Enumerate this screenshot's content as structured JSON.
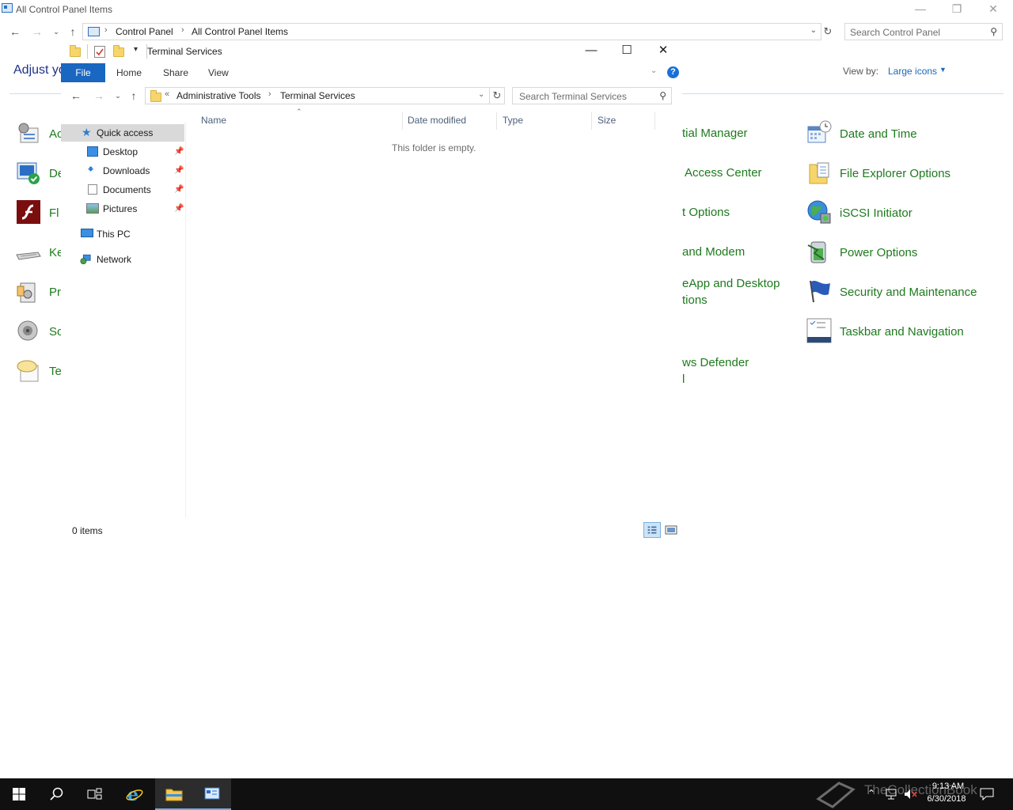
{
  "control_panel": {
    "title": "All Control Panel Items",
    "breadcrumb": [
      "Control Panel",
      "All Control Panel Items"
    ],
    "search_placeholder": "Search Control Panel",
    "heading": "Adjust yo",
    "view_by_label": "View by:",
    "view_by_value": "Large icons",
    "left_items": [
      "Ac",
      "De",
      "Fl",
      "Ke",
      "Pr",
      "So",
      "Te"
    ],
    "middle_partial": [
      "tial Manager",
      "Access Center",
      "t Options",
      "and Modem",
      "eApp and Desktop",
      "tions",
      "ws Defender",
      "l"
    ],
    "right_items": [
      "Date and Time",
      "File Explorer Options",
      "iSCSI Initiator",
      "Power Options",
      "Security and Maintenance",
      "Taskbar and Navigation"
    ]
  },
  "explorer": {
    "title": "Terminal Services",
    "ribbon_tabs": [
      "File",
      "Home",
      "Share",
      "View"
    ],
    "help_glyph": "?",
    "breadcrumb_overflow": "«",
    "breadcrumb": [
      "Administrative Tools",
      "Terminal Services"
    ],
    "search_placeholder": "Search Terminal Services",
    "nav": {
      "quick_access": "Quick access",
      "desktop": "Desktop",
      "downloads": "Downloads",
      "documents": "Documents",
      "pictures": "Pictures",
      "this_pc": "This PC",
      "network": "Network"
    },
    "columns": [
      "Name",
      "Date modified",
      "Type",
      "Size"
    ],
    "empty_message": "This folder is empty.",
    "status": "0 items"
  },
  "taskbar": {
    "time": "9:13 AM",
    "date": "6/30/2018",
    "watermark": "TheCollectionBook"
  }
}
